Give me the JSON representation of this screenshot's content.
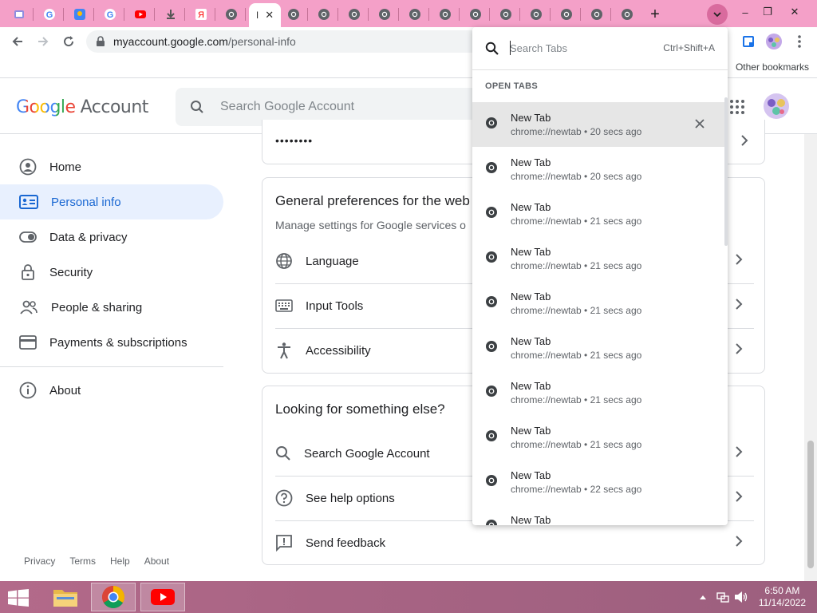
{
  "browser": {
    "active_tab_label": "I",
    "new_tab_symbol": "+",
    "omnibox": {
      "host": "myaccount.google.com",
      "path": "/personal-info"
    },
    "other_bookmarks": "Other bookmarks",
    "window_controls": [
      "–",
      "❐",
      "✕"
    ]
  },
  "header": {
    "logo_google": "Google",
    "logo_account": "Account",
    "search_placeholder": "Search Google Account"
  },
  "password_mask": "••••••••",
  "sidebar": {
    "items": [
      {
        "label": "Home",
        "icon": "home-icon"
      },
      {
        "label": "Personal info",
        "icon": "id-card-icon"
      },
      {
        "label": "Data & privacy",
        "icon": "toggle-icon"
      },
      {
        "label": "Security",
        "icon": "lock-icon"
      },
      {
        "label": "People & sharing",
        "icon": "people-icon"
      },
      {
        "label": "Payments & subscriptions",
        "icon": "card-icon"
      },
      {
        "label": "About",
        "icon": "info-icon"
      }
    ],
    "footer": [
      "Privacy",
      "Terms",
      "Help",
      "About"
    ]
  },
  "prefs_card": {
    "title": "General preferences for the web",
    "subtitle": "Manage settings for Google services o",
    "rows": [
      {
        "label": "Language",
        "icon": "globe-icon"
      },
      {
        "label": "Input Tools",
        "icon": "keyboard-icon"
      },
      {
        "label": "Accessibility",
        "icon": "accessibility-icon"
      }
    ]
  },
  "else_card": {
    "title": "Looking for something else?",
    "rows": [
      {
        "label": "Search Google Account",
        "icon": "search-icon"
      },
      {
        "label": "See help options",
        "icon": "help-icon"
      },
      {
        "label": "Send feedback",
        "icon": "feedback-icon"
      }
    ]
  },
  "tab_search": {
    "placeholder": "Search Tabs",
    "shortcut": "Ctrl+Shift+A",
    "section": "OPEN TABS",
    "items": [
      {
        "title": "New Tab",
        "url": "chrome://newtab",
        "age": "20 secs ago"
      },
      {
        "title": "New Tab",
        "url": "chrome://newtab",
        "age": "20 secs ago"
      },
      {
        "title": "New Tab",
        "url": "chrome://newtab",
        "age": "21 secs ago"
      },
      {
        "title": "New Tab",
        "url": "chrome://newtab",
        "age": "21 secs ago"
      },
      {
        "title": "New Tab",
        "url": "chrome://newtab",
        "age": "21 secs ago"
      },
      {
        "title": "New Tab",
        "url": "chrome://newtab",
        "age": "21 secs ago"
      },
      {
        "title": "New Tab",
        "url": "chrome://newtab",
        "age": "21 secs ago"
      },
      {
        "title": "New Tab",
        "url": "chrome://newtab",
        "age": "21 secs ago"
      },
      {
        "title": "New Tab",
        "url": "chrome://newtab",
        "age": "22 secs ago"
      },
      {
        "title": "New Tab",
        "url": "",
        "age": ""
      }
    ]
  },
  "taskbar": {
    "time": "6:50 AM",
    "date": "11/14/2022"
  },
  "colors": {
    "tabstrip": "#f4a0c8",
    "accent_blue": "#1a73e8",
    "active_nav_bg": "#e8f0fe"
  }
}
